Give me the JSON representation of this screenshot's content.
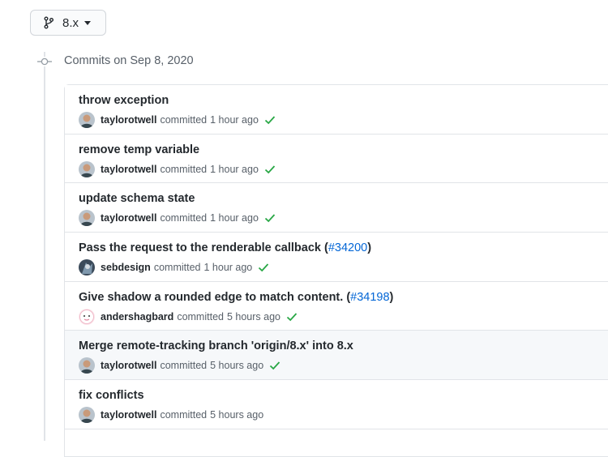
{
  "branch": {
    "name": "8.x"
  },
  "group": {
    "title": "Commits on Sep 8, 2020"
  },
  "commits": [
    {
      "title": "throw exception",
      "pr": "",
      "author": "taylorotwell",
      "action": "committed",
      "time": "1 hour ago",
      "status": "success",
      "avatar": "taylor"
    },
    {
      "title": "remove temp variable",
      "pr": "",
      "author": "taylorotwell",
      "action": "committed",
      "time": "1 hour ago",
      "status": "success",
      "avatar": "taylor"
    },
    {
      "title": "update schema state",
      "pr": "",
      "author": "taylorotwell",
      "action": "committed",
      "time": "1 hour ago",
      "status": "success",
      "avatar": "taylor"
    },
    {
      "title": "Pass the request to the renderable callback (",
      "pr": "#34200",
      "title_end": ")",
      "author": "sebdesign",
      "action": "committed",
      "time": "1 hour ago",
      "status": "success",
      "avatar": "seb"
    },
    {
      "title": "Give shadow a rounded edge to match content. (",
      "pr": "#34198",
      "title_end": ")",
      "author": "andershagbard",
      "action": "committed",
      "time": "5 hours ago",
      "status": "success",
      "avatar": "anders"
    },
    {
      "title": "Merge remote-tracking branch 'origin/8.x' into 8.x",
      "pr": "",
      "author": "taylorotwell",
      "action": "committed",
      "time": "5 hours ago",
      "status": "success",
      "avatar": "taylor"
    },
    {
      "title": "fix conflicts",
      "pr": "",
      "author": "taylorotwell",
      "action": "committed",
      "time": "5 hours ago",
      "status": "none",
      "avatar": "taylor"
    }
  ],
  "colors": {
    "success": "#28a745",
    "link": "#0366d6",
    "muted": "#586069"
  }
}
